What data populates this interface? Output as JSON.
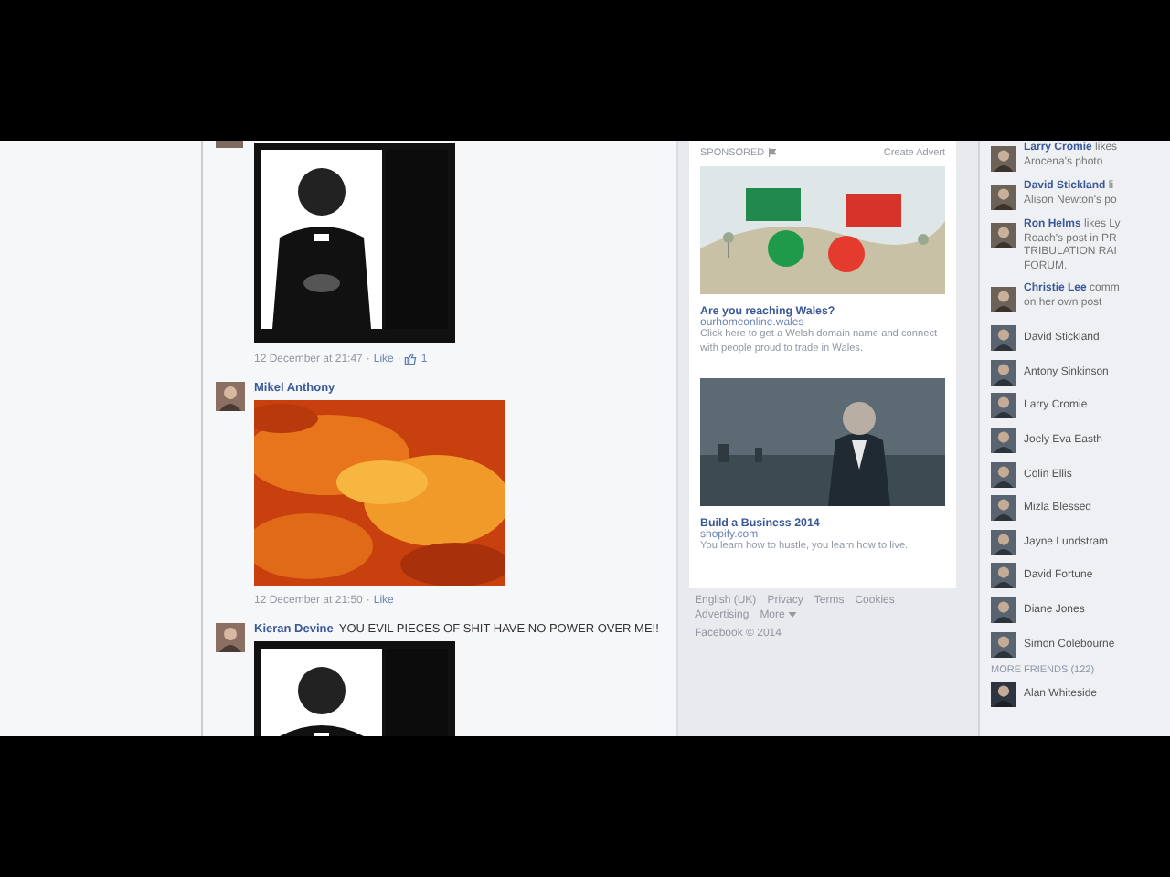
{
  "comments": [
    {
      "timestamp": "12 December at 21:47",
      "separator": "·",
      "like": "Like",
      "like_count": "1"
    },
    {
      "author": "Mikel Anthony",
      "timestamp": "12 December at 21:50",
      "separator": "·",
      "like": "Like"
    },
    {
      "author": "Kieran Devine",
      "text": "YOU EVIL PIECES OF SHIT HAVE NO POWER OVER ME!!"
    }
  ],
  "sponsored": {
    "label": "SPONSORED",
    "create": "Create Advert",
    "ads": [
      {
        "title": "Are you reaching Wales?",
        "domain": "ourhomeonline.wales",
        "body": "Click here to get a Welsh domain name and connect with people proud to trade in Wales."
      },
      {
        "title": "Build a Business 2014",
        "domain": "shopify.com",
        "body": "You learn how to hustle, you learn how to live."
      }
    ]
  },
  "footer": {
    "links": [
      "English (UK)",
      "Privacy",
      "Terms",
      "Cookies",
      "Advertising",
      "More"
    ],
    "copyright": "Facebook © 2014"
  },
  "ticker": [
    {
      "lines": [
        "**Larry Cromie** likes",
        "Arocena's photo"
      ]
    },
    {
      "lines": [
        "**David Stickland** li",
        "Alison Newton's po"
      ]
    },
    {
      "lines": [
        "**Ron Helms** likes Ly",
        "Roach's post in PR",
        "TRIBULATION RAI",
        "FORUM."
      ]
    },
    {
      "lines": [
        "**Christie Lee** comm",
        "on her own post"
      ]
    }
  ],
  "friends": [
    {
      "name": "David Stickland"
    },
    {
      "name": "Antony Sinkinson"
    },
    {
      "name": "Larry Cromie"
    },
    {
      "name": "Joely Eva Easth"
    },
    {
      "name": "Colin Ellis"
    },
    {
      "name": "Mizla Blessed"
    },
    {
      "name": "Jayne Lundstram"
    },
    {
      "name": "David Fortune"
    },
    {
      "name": "Diane Jones"
    },
    {
      "name": "Simon Colebourne"
    }
  ],
  "more_friends": {
    "heading": "MORE FRIENDS (122)",
    "friends": [
      {
        "name": "Alan Whiteside"
      }
    ]
  }
}
